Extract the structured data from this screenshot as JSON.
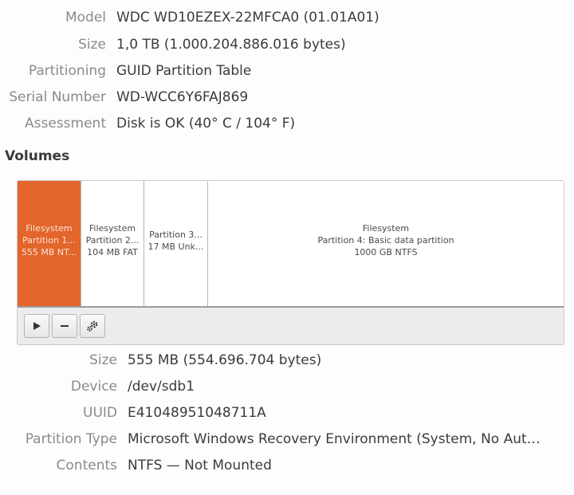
{
  "drive": {
    "rows": [
      {
        "label": "Model",
        "value": "WDC WD10EZEX-22MFCA0 (01.01A01)"
      },
      {
        "label": "Size",
        "value": "1,0 TB (1.000.204.886.016 bytes)"
      },
      {
        "label": "Partitioning",
        "value": "GUID Partition Table"
      },
      {
        "label": "Serial Number",
        "value": "WD-WCC6Y6FAJ869"
      },
      {
        "label": "Assessment",
        "value": "Disk is OK (40° C / 104° F)"
      }
    ]
  },
  "volumes": {
    "heading": "Volumes",
    "partitions": [
      {
        "line1": "Filesystem",
        "line2": "Partition 1...",
        "line3": "555 MB NT..."
      },
      {
        "line1": "Filesystem",
        "line2": "Partition 2...",
        "line3": "104 MB FAT"
      },
      {
        "line1": "",
        "line2": "Partition 3...",
        "line3": "17 MB Unk..."
      },
      {
        "line1": "Filesystem",
        "line2": "Partition 4: Basic data partition",
        "line3": "1000 GB NTFS"
      }
    ],
    "selected_color": "#e2652c",
    "toolbar": {
      "play_icon": "play-icon",
      "remove_icon": "minus-icon",
      "settings_icon": "gears-icon"
    }
  },
  "selected_partition": {
    "rows": [
      {
        "label": "Size",
        "value": "555 MB (554.696.704 bytes)"
      },
      {
        "label": "Device",
        "value": "/dev/sdb1"
      },
      {
        "label": "UUID",
        "value": "E41048951048711A"
      },
      {
        "label": "Partition Type",
        "value": "Microsoft Windows Recovery Environment (System, No Aut…"
      },
      {
        "label": "Contents",
        "value": "NTFS — Not Mounted"
      }
    ]
  }
}
